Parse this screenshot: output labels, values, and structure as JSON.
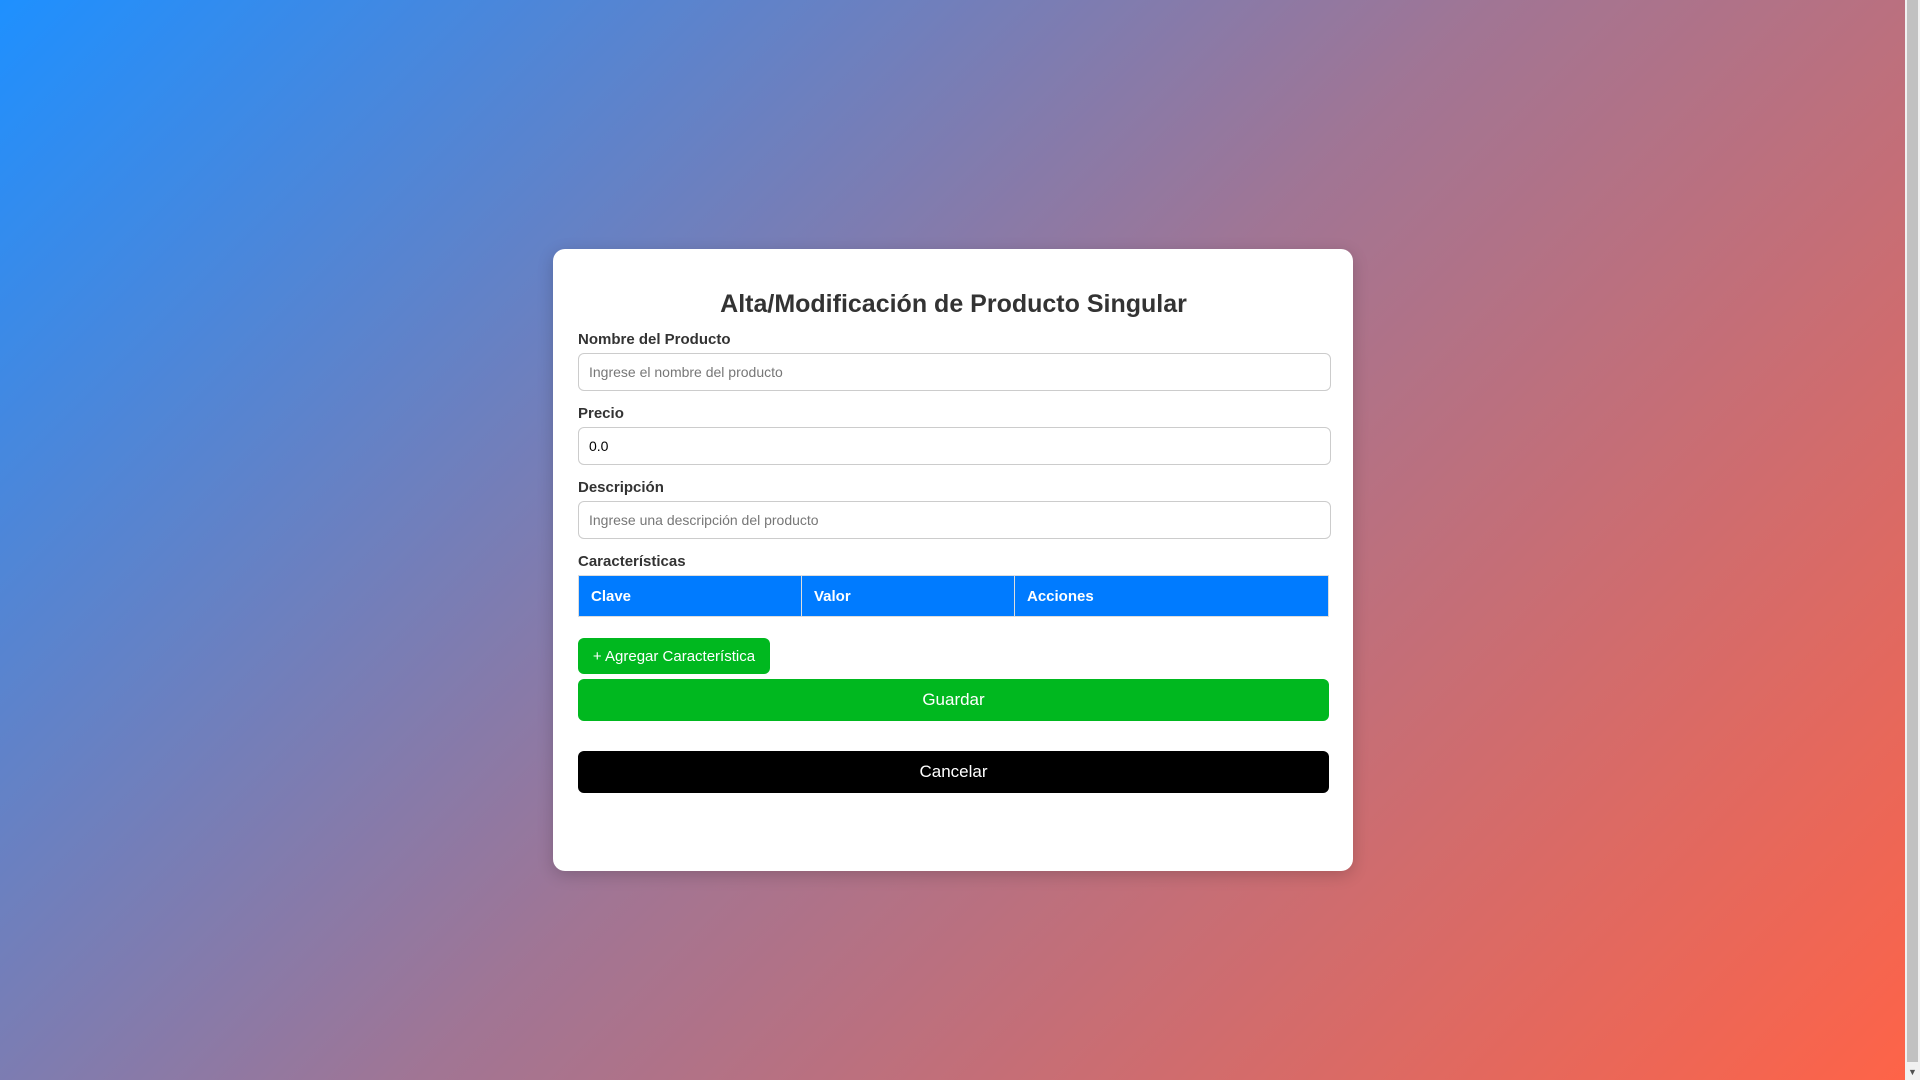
{
  "form": {
    "title": "Alta/Modificación de Producto Singular",
    "name": {
      "label": "Nombre del Producto",
      "value": "",
      "placeholder": "Ingrese el nombre del producto"
    },
    "price": {
      "label": "Precio",
      "value": "0.0",
      "placeholder": ""
    },
    "description": {
      "label": "Descripción",
      "value": "",
      "placeholder": "Ingrese una descripción del producto"
    },
    "features": {
      "label": "Características",
      "columns": [
        "Clave",
        "Valor",
        "Acciones"
      ],
      "rows": []
    },
    "add_feature_label": "+ Agregar Característica",
    "save_label": "Guardar",
    "cancel_label": "Cancelar"
  },
  "colors": {
    "header_blue": "#007bff",
    "button_green": "#00b81f",
    "cancel_black": "#000000",
    "bg_gradient_start": "#1e90ff",
    "bg_gradient_end": "#ff6347"
  }
}
